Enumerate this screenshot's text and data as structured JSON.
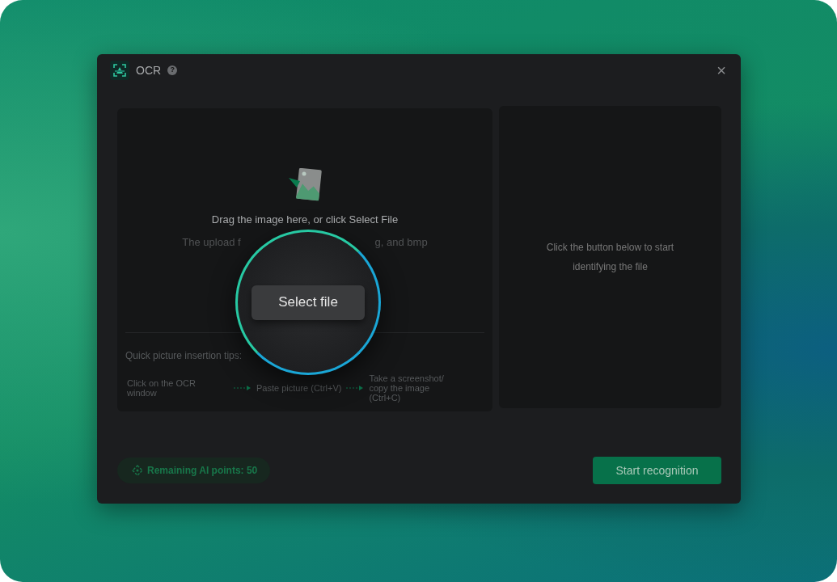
{
  "window": {
    "title": "OCR",
    "help": "?",
    "close": "×"
  },
  "upload": {
    "prompt": "Drag the image here, or click Select File",
    "hint_left": "The upload f",
    "hint_right": "g, and bmp",
    "button": "Select file"
  },
  "tips": {
    "title": "Quick picture insertion tips:",
    "steps": [
      "Click on the OCR window",
      "Paste picture (Ctrl+V)",
      "Take a screenshot/ copy the image (Ctrl+C)"
    ]
  },
  "result": {
    "message": "Click the button below to start identifying the file"
  },
  "footer": {
    "points": "Remaining AI points: 50",
    "start_button": "Start recognition"
  }
}
